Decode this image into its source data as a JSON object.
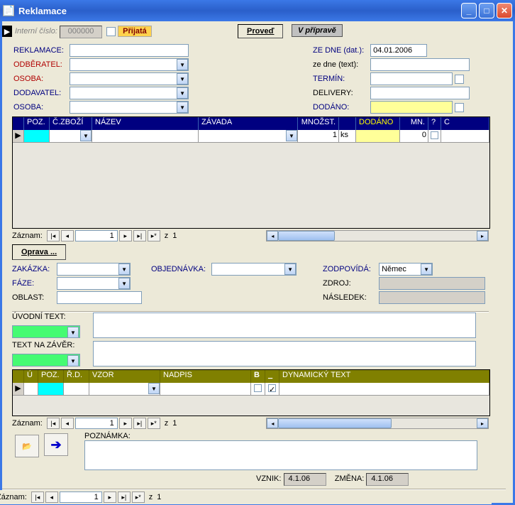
{
  "window": {
    "title": "Reklamace"
  },
  "header": {
    "interni_cislo_label": "Interní číslo:",
    "interni_cislo_value": "000000",
    "prijata_label": "Přijatá",
    "proved_btn": "Proveď",
    "status_label": "V přípravě"
  },
  "top_left": {
    "reklamace": "REKLAMACE:",
    "odberatel": "ODBĚRATEL:",
    "osoba1": "OSOBA:",
    "dodavatel": "DODAVATEL:",
    "osoba2": "OSOBA:"
  },
  "top_right": {
    "ze_dne_dat": "ZE DNE (dat.):",
    "ze_dne_dat_val": "04.01.2006",
    "ze_dne_text": "ze dne (text):",
    "termin": "TERMÍN:",
    "delivery": "DELIVERY:",
    "dodano": "DODÁNO:"
  },
  "grid1": {
    "headers": [
      "POZ.",
      "Č.ZBOŽÍ",
      "NÁZEV",
      "ZÁVADA",
      "MNOŽST.",
      "",
      "DODÁNO",
      "MN.",
      "?",
      "C"
    ],
    "row": {
      "mnozst": "1",
      "unit": "ks",
      "mn": "0"
    }
  },
  "recnav": {
    "label": "Záznam:",
    "value": "1",
    "of": "z",
    "total": "1"
  },
  "oprava_btn": "Oprava ...",
  "mid_left": {
    "zakazka": "ZAKÁZKA:",
    "faze": "FÁZE:",
    "oblast": "OBLAST:"
  },
  "mid_center": {
    "objednavka": "OBJEDNÁVKA:"
  },
  "mid_right": {
    "zodpovida": "ZODPOVÍDÁ:",
    "zodpovida_val": "Němec",
    "zdroj": "ZDROJ:",
    "nasledek": "NÁSLEDEK:"
  },
  "texts": {
    "uvodni": "ÚVODNÍ TEXT:",
    "zaver": "TEXT NA ZÁVĚR:"
  },
  "grid2": {
    "headers": [
      "Ú",
      "POZ.",
      "Ř.D.",
      "VZOR",
      "NADPIS",
      "B",
      "_",
      "DYNAMICKÝ TEXT"
    ]
  },
  "bottom": {
    "poznamka": "POZNÁMKA:",
    "vznik": "VZNIK:",
    "vznik_val": "4.1.06",
    "zmena": "ZMĚNA:",
    "zmena_val": "4.1.06"
  }
}
